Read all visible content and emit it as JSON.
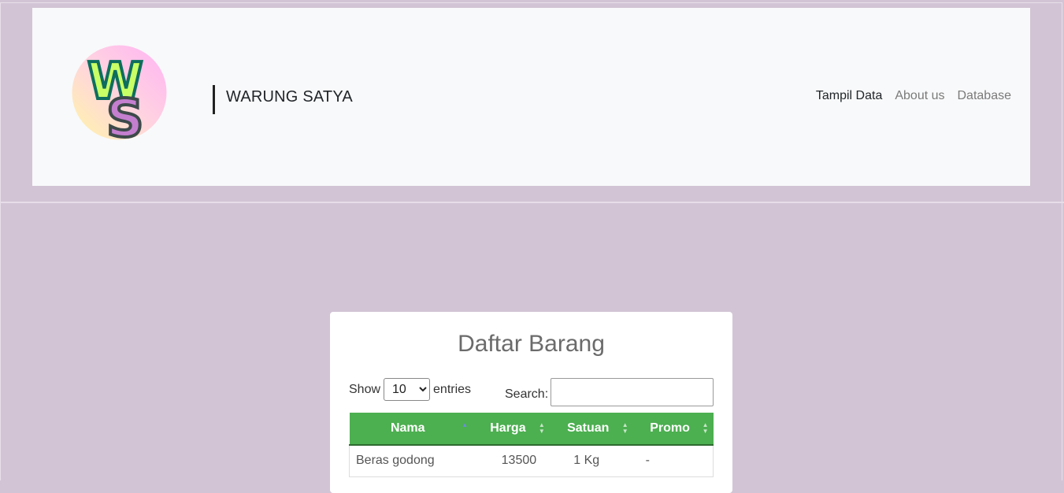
{
  "brand": {
    "name": "WARUNG SATYA",
    "logo_text_w": "W",
    "logo_text_s": "S"
  },
  "nav": {
    "items": [
      {
        "label": "Tampil Data",
        "active": true
      },
      {
        "label": "About us",
        "active": false
      },
      {
        "label": "Database",
        "active": false
      }
    ]
  },
  "card": {
    "title": "Daftar Barang",
    "length": {
      "prefix": "Show",
      "selected": "10",
      "options": [
        "10"
      ],
      "suffix": "entries"
    },
    "search": {
      "label": "Search:",
      "value": ""
    },
    "table": {
      "columns": [
        "Nama",
        "Harga",
        "Satuan",
        "Promo"
      ],
      "rows": [
        {
          "nama": "Beras godong",
          "harga": "13500",
          "satuan": "1 Kg",
          "promo": "-"
        }
      ]
    }
  },
  "colors": {
    "background": "#d2c4d5",
    "navbar": "#f8f9fa",
    "table_header": "#4caf50"
  }
}
